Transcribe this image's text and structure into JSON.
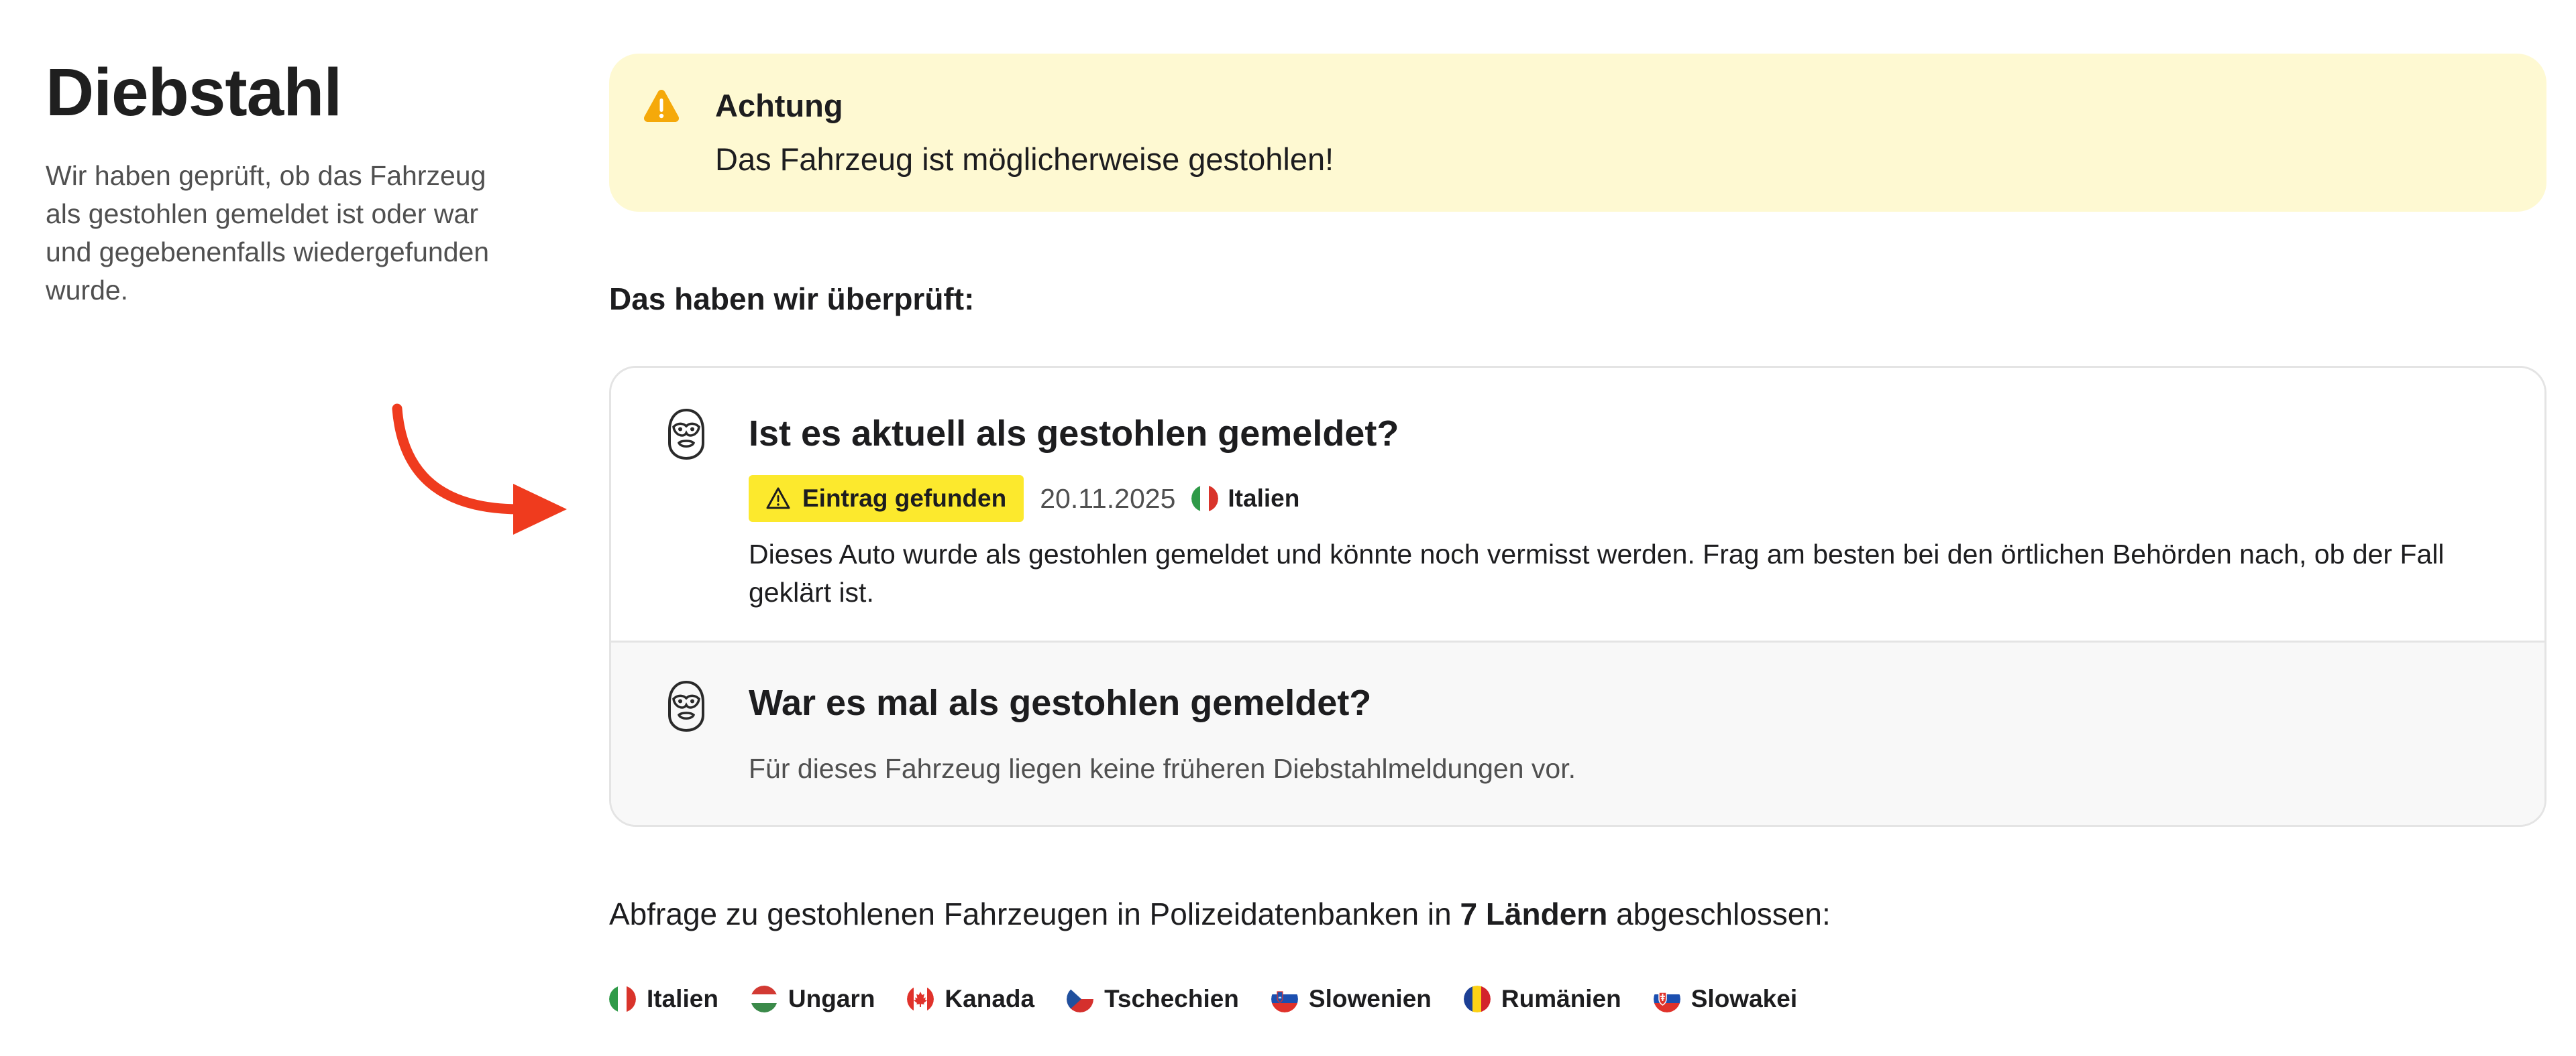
{
  "page": {
    "title": "Diebstahl",
    "description": "Wir haben geprüft, ob das Fahrzeug als gestohlen gemeldet ist oder war und gegebenenfalls wiedergefunden wurde."
  },
  "alert": {
    "icon": "warning-icon",
    "title": "Achtung",
    "message": "Das Fahrzeug ist möglicherweise gestohlen!",
    "color": "#fef9d2",
    "icon_color": "#f5a90a"
  },
  "checked_heading": "Das haben wir überprüft:",
  "checks": [
    {
      "icon": "balaclava-icon",
      "title": "Ist es aktuell als gestohlen gemeldet?",
      "badge": {
        "icon": "warning-icon",
        "label": "Eintrag gefunden",
        "color": "#fce92d"
      },
      "date": "20.11.2025",
      "country": "Italien",
      "text": "Dieses Auto wurde als gestohlen gemeldet und könnte noch vermisst werden. Frag am besten bei den örtlichen Behörden nach, ob der Fall geklärt ist."
    },
    {
      "icon": "balaclava-icon",
      "title": "War es mal als gestohlen gemeldet?",
      "text": "Für dieses Fahrzeug liegen keine früheren Diebstahlmeldungen vor."
    }
  ],
  "summary": {
    "prefix": "Abfrage zu gestohlenen Fahrzeugen in Polizeidatenbanken in",
    "count": "7 Ländern",
    "suffix": "abgeschlossen:"
  },
  "countries": [
    {
      "name": "Italien",
      "flag": "italy-flag-icon"
    },
    {
      "name": "Ungarn",
      "flag": "hungary-flag-icon"
    },
    {
      "name": "Kanada",
      "flag": "canada-flag-icon"
    },
    {
      "name": "Tschechien",
      "flag": "czech-flag-icon"
    },
    {
      "name": "Slowenien",
      "flag": "slovenia-flag-icon"
    },
    {
      "name": "Rumänien",
      "flag": "romania-flag-icon"
    },
    {
      "name": "Slowakei",
      "flag": "slovakia-flag-icon"
    }
  ],
  "annotation": {
    "icon": "red-arrow-icon",
    "color": "#ef3b1e"
  }
}
